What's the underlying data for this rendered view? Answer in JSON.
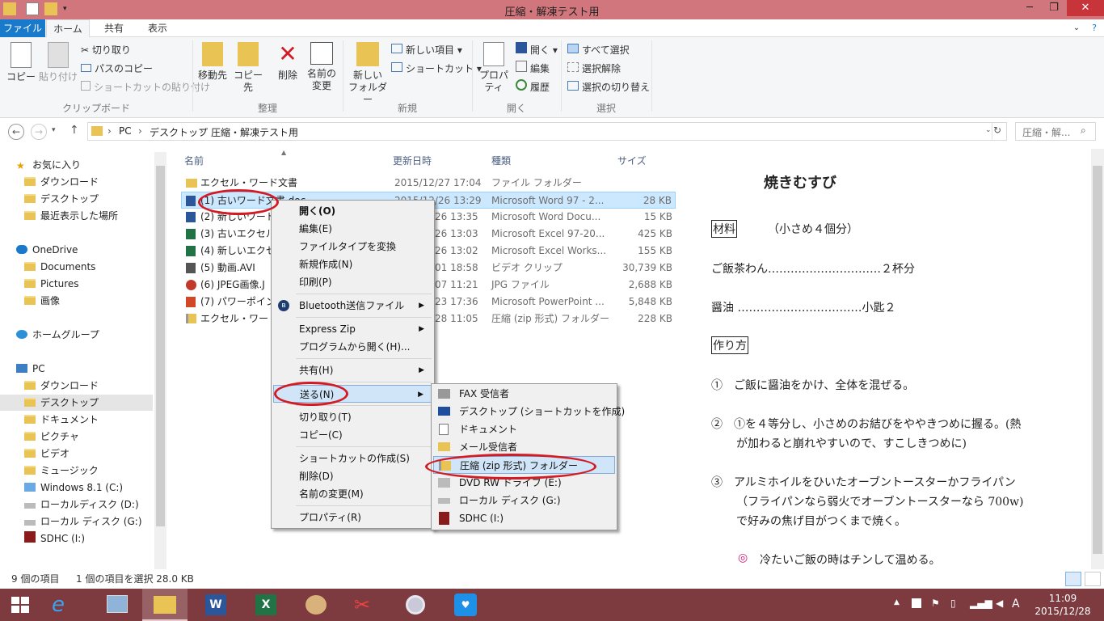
{
  "window": {
    "title": "圧縮・解凍テスト用",
    "minimize": "─",
    "restore": "❐",
    "close": "✕"
  },
  "tabs": [
    "ファイル",
    "ホーム",
    "共有",
    "表示"
  ],
  "ribbon": {
    "clipboard": {
      "copy": "コピー",
      "paste": "貼り付け",
      "cut": "切り取り",
      "copy_path": "パスのコピー",
      "paste_shortcut": "ショートカットの貼り付け",
      "group": "クリップボード"
    },
    "organize": {
      "move_to": "移動先",
      "copy_to": "コピー先",
      "delete": "削除",
      "rename_1": "名前の",
      "rename_2": "変更",
      "group": "整理"
    },
    "new": {
      "new_folder_1": "新しい",
      "new_folder_2": "フォルダー",
      "new_item": "新しい項目",
      "shortcut": "ショートカット",
      "group": "新規"
    },
    "open": {
      "properties": "プロパティ",
      "open": "開く",
      "edit": "編集",
      "history": "履歴",
      "group": "開く"
    },
    "select": {
      "select_all": "すべて選択",
      "select_none": "選択解除",
      "invert": "選択の切り替え",
      "group": "選択"
    }
  },
  "address": {
    "pc": "PC",
    "desktop": "デスクトップ",
    "folder": "圧縮・解凍テスト用",
    "search_placeholder": "圧縮・解..."
  },
  "nav": [
    {
      "label": "お気に入り",
      "icon": "star-icon"
    },
    {
      "label": "ダウンロード",
      "icon": "folder-icon"
    },
    {
      "label": "デスクトップ",
      "icon": "folder-icon"
    },
    {
      "label": "最近表示した場所",
      "icon": "folder-icon"
    },
    {
      "label": "OneDrive",
      "icon": "cloud-icon"
    },
    {
      "label": "Documents",
      "icon": "folder-icon"
    },
    {
      "label": "Pictures",
      "icon": "folder-icon"
    },
    {
      "label": "画像",
      "icon": "folder-icon"
    },
    {
      "label": "ホームグループ",
      "icon": "homegroup-icon"
    },
    {
      "label": "PC",
      "icon": "pc-icon"
    },
    {
      "label": "ダウンロード",
      "icon": "folder-icon"
    },
    {
      "label": "デスクトップ",
      "icon": "folder-icon"
    },
    {
      "label": "ドキュメント",
      "icon": "folder-icon"
    },
    {
      "label": "ピクチャ",
      "icon": "folder-icon"
    },
    {
      "label": "ビデオ",
      "icon": "folder-icon"
    },
    {
      "label": "ミュージック",
      "icon": "folder-icon"
    },
    {
      "label": "Windows 8.1 (C:)",
      "icon": "drive-icon"
    },
    {
      "label": "ローカルディスク (D:)",
      "icon": "drive-icon"
    },
    {
      "label": "ローカル ディスク (G:)",
      "icon": "drive-icon"
    },
    {
      "label": "SDHC (I:)",
      "icon": "sd-icon"
    }
  ],
  "columns": [
    "名前",
    "更新日時",
    "種類",
    "サイズ"
  ],
  "files": [
    {
      "name": "エクセル・ワード文書",
      "date": "2015/12/27 17:04",
      "type": "ファイル フォルダー",
      "size": ""
    },
    {
      "name": "(1) 古いワード文書.doc",
      "date": "2015/12/26 13:29",
      "type": "Microsoft Word 97 - 2...",
      "size": "28 KB"
    },
    {
      "name": "(2) 新しいワード文",
      "date": "26 13:35",
      "type": "Microsoft Word Docu...",
      "size": "15 KB"
    },
    {
      "name": "(3) 古いエクセル表",
      "date": "26 13:03",
      "type": "Microsoft Excel 97-20...",
      "size": "425 KB"
    },
    {
      "name": "(4) 新しいエクセル",
      "date": "26 13:02",
      "type": "Microsoft Excel Works...",
      "size": "155 KB"
    },
    {
      "name": "(5) 動画.AVI",
      "date": "01 18:58",
      "type": "ビデオ クリップ",
      "size": "30,739 KB"
    },
    {
      "name": "(6)  JPEG画像.J",
      "date": "07 11:21",
      "type": "JPG ファイル",
      "size": "2,688 KB"
    },
    {
      "name": "(7) パワーポイント",
      "date": "23 17:36",
      "type": "Microsoft PowerPoint ...",
      "size": "5,848 KB"
    },
    {
      "name": "エクセル・ワード文書",
      "date": "28 11:05",
      "type": "圧縮 (zip 形式) フォルダー",
      "size": "228 KB"
    }
  ],
  "context_menu": [
    "開く(O)",
    "編集(E)",
    "ファイルタイプを変換",
    "新規作成(N)",
    "印刷(P)",
    "Bluetooth送信ファイル",
    "Express Zip",
    "プログラムから開く(H)...",
    "共有(H)",
    "送る(N)",
    "切り取り(T)",
    "コピー(C)",
    "ショートカットの作成(S)",
    "削除(D)",
    "名前の変更(M)",
    "プロパティ(R)"
  ],
  "send_to_menu": [
    "FAX 受信者",
    "デスクトップ (ショートカットを作成)",
    "ドキュメント",
    "メール受信者",
    "圧縮 (zip 形式) フォルダー",
    "DVD RW ドライブ (E:)",
    "ローカル ディスク (G:)",
    "SDHC (I:)"
  ],
  "preview": {
    "title": "焼きむすび",
    "ingredients_label": "材料",
    "ingredients_note": "（小さめ４個分）",
    "rice": "ご飯茶わん…………………………２杯分",
    "soy": "醤油 ……………………………小匙２",
    "method_label": "作り方",
    "step1": "①　ご飯に醤油をかけ、全体を混ぜる。",
    "step2a": "②　①を４等分し、小さめのお結びをややきつめに握る。(熱",
    "step2b": "が加わると崩れやすいので、すこしきつめに)",
    "step3a": "③　アルミホイルをひいたオーブントースターかフライパン",
    "step3b": "（フライパンなら弱火でオーブントースターなら 700w)",
    "step3c": "で好みの焦げ目がつくまで焼く。",
    "note": "冷たいご飯の時はチンして温める。"
  },
  "status": {
    "count": "9 個の項目",
    "selected": "1 個の項目を選択  28.0 KB"
  },
  "clock": {
    "time": "11:09",
    "date": "2015/12/28"
  },
  "ime": "A",
  "colors": {
    "titlebar": "#d2767d",
    "taskbar": "#7d3a3f",
    "accent": "#1979ca",
    "highlight_oval": "#d41b24"
  }
}
